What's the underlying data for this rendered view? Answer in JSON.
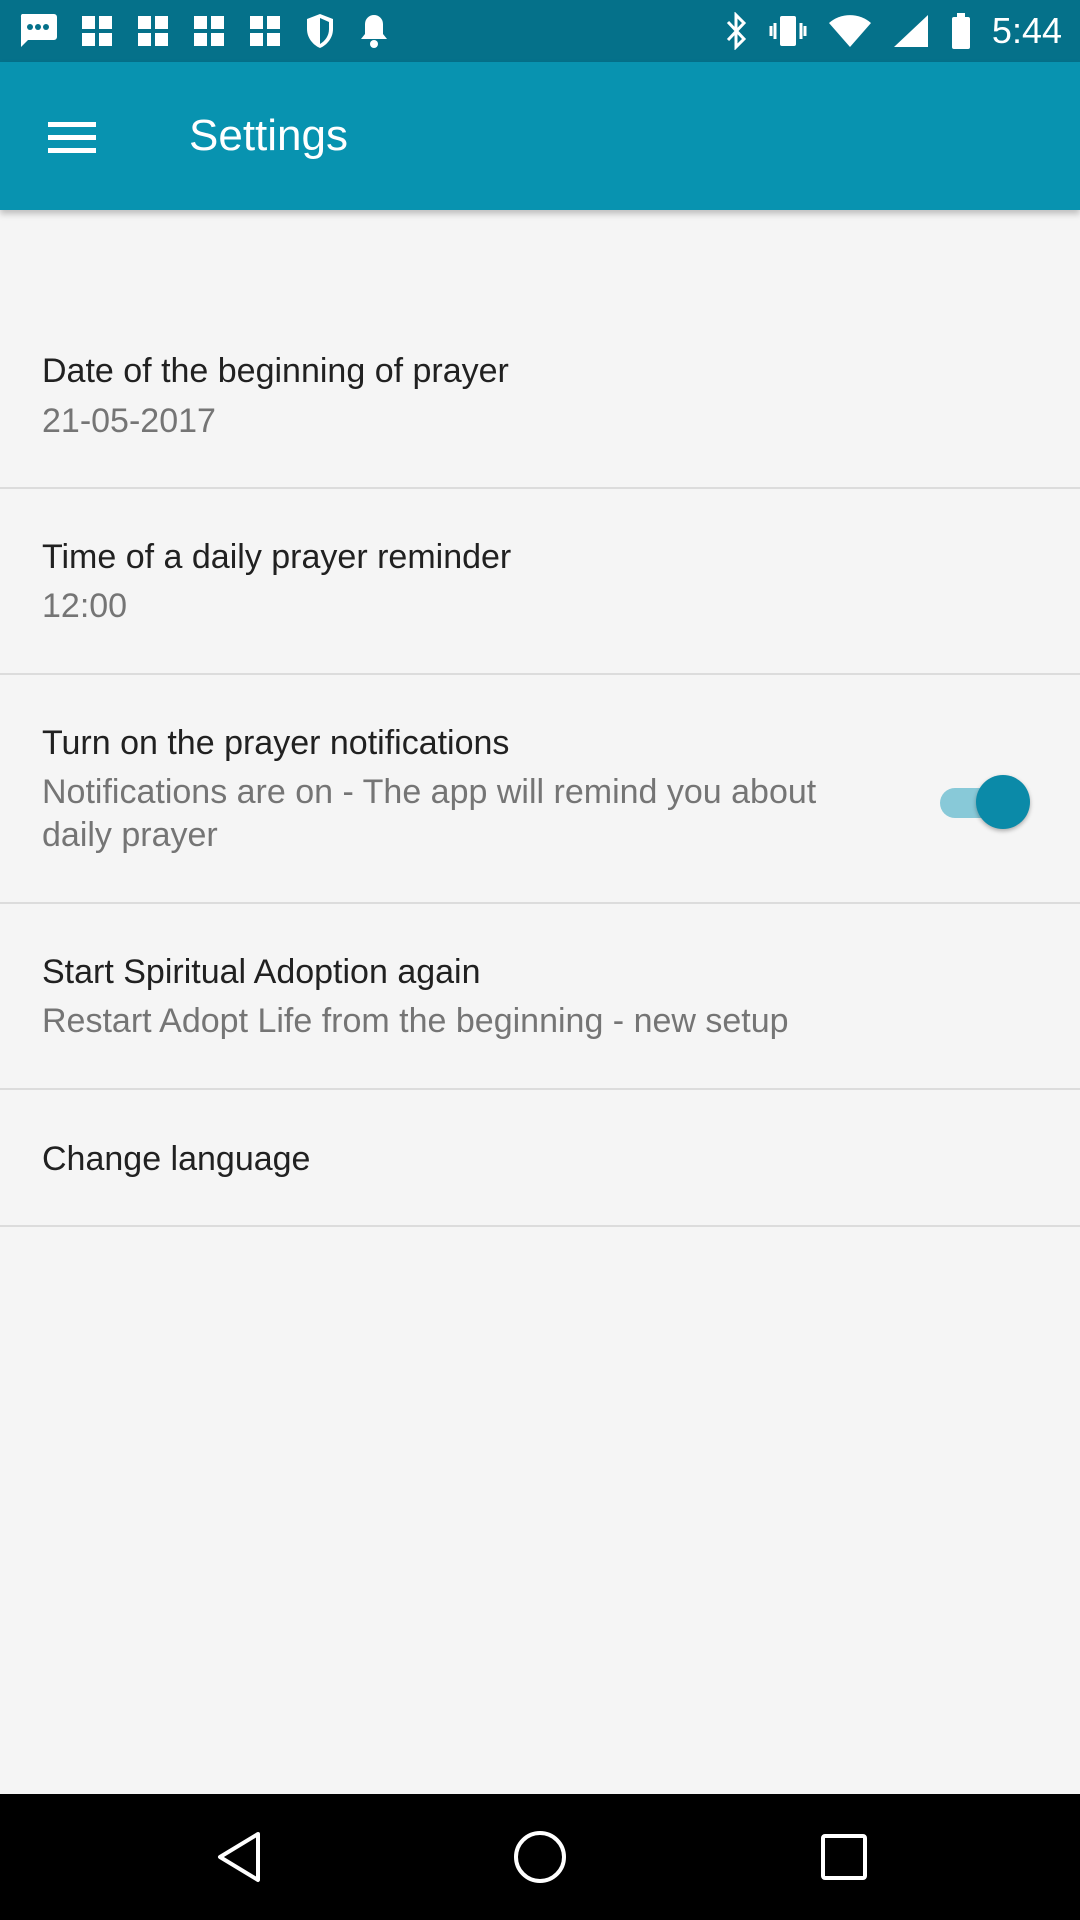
{
  "status_bar": {
    "time": "5:44",
    "icons": [
      "chat-icon",
      "image-icon",
      "image-icon",
      "image-icon",
      "image-icon",
      "shield-icon",
      "bell-icon",
      "bluetooth-icon",
      "vibrate-icon",
      "wifi-icon",
      "signal-icon",
      "battery-icon"
    ]
  },
  "app_bar": {
    "title": "Settings",
    "menu_icon": "menu-icon",
    "background": "#0893b0"
  },
  "settings": {
    "start_date": {
      "title": "Date of the beginning of prayer",
      "summary": "21-05-2017"
    },
    "reminder_time": {
      "title": "Time of a daily prayer reminder",
      "summary": "12:00"
    },
    "notifications": {
      "title": "Turn on the prayer notifications",
      "summary": "Notifications are on - The app will remind you about daily prayer",
      "enabled": true
    },
    "restart": {
      "title": "Start Spiritual Adoption again",
      "summary": "Restart Adopt Life from the beginning - new setup"
    },
    "language": {
      "title": "Change language"
    }
  },
  "nav_bar": {
    "back_icon": "back-icon",
    "home_icon": "home-icon",
    "recents_icon": "recents-icon"
  },
  "colors": {
    "accent": "#0893b0",
    "status_bar": "#05718a",
    "background": "#f5f5f5"
  }
}
